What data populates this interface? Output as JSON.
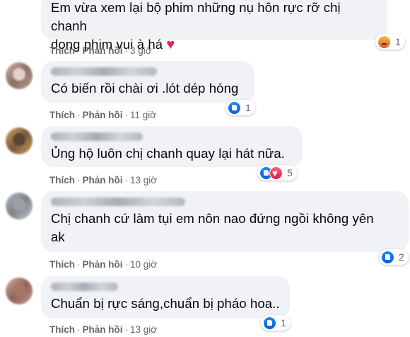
{
  "comments": [
    {
      "text_line1": "Em vừa xem lại bộ phim những nụ hôn rực rỡ chị chanh",
      "text_line2": "dong phim vui à há",
      "heart": "♥",
      "like": "Thích",
      "reply": "Phản hồi",
      "sep": "·",
      "time": "3 giờ",
      "reactions": [
        "angry-reaction"
      ],
      "reaction_count": "1"
    },
    {
      "text": "Có biến rồi chài ơi .lót dép hóng",
      "like": "Thích",
      "reply": "Phản hồi",
      "sep": "·",
      "time": "11 giờ",
      "reactions": [
        "like-reaction"
      ],
      "reaction_count": "1"
    },
    {
      "text": "Ủng hộ luôn chị chanh quay lại hát nữa.",
      "like": "Thích",
      "reply": "Phản hồi",
      "sep": "·",
      "time": "13 giờ",
      "reactions": [
        "like-reaction",
        "love-reaction"
      ],
      "reaction_count": "5"
    },
    {
      "text_line1": "Chị chanh cứ làm tụi em nôn nao đứng ngồi không yên",
      "text_line2": "ak",
      "like": "Thích",
      "reply": "Phản hồi",
      "sep": "·",
      "time": "10 giờ",
      "reactions": [
        "like-reaction"
      ],
      "reaction_count": "2"
    },
    {
      "text": "Chuẩn bị rực sáng,chuẩn bị pháo hoa..",
      "like": "Thích",
      "reply": "Phản hồi",
      "sep": "·",
      "time": "13 giờ",
      "reactions": [
        "like-reaction"
      ],
      "reaction_count": "1"
    }
  ],
  "colors": {
    "bubble": "#f0f2f5",
    "meta_text": "#65676b",
    "like_blue": "#1877f2",
    "love_red": "#f02849"
  }
}
